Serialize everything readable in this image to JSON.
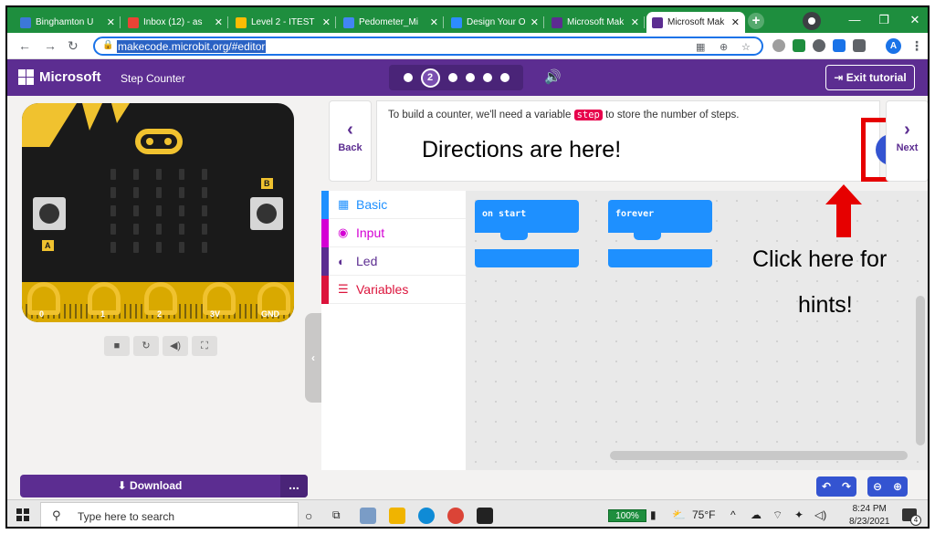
{
  "browser": {
    "tabs": [
      {
        "label": "Binghamton U",
        "color": "#3c78d8"
      },
      {
        "label": "Inbox (12) - as",
        "color": "#ea4335"
      },
      {
        "label": "Level 2 - ITEST",
        "color": "#fbbc04"
      },
      {
        "label": "Pedometer_Mi",
        "color": "#4285f4"
      },
      {
        "label": "Design Your O",
        "color": "#2d8cff"
      },
      {
        "label": "Microsoft Mak",
        "color": "#5c2d91"
      },
      {
        "label": "Microsoft Mak",
        "color": "#5c2d91"
      }
    ],
    "close_glyph": "✕",
    "new_tab": "+",
    "url": "makecode.microbit.org/#editor",
    "profile_initial": "A"
  },
  "header": {
    "brand": "Microsoft",
    "project": "Step Counter",
    "current_step": "2",
    "exit_label": "Exit tutorial"
  },
  "simulator": {
    "button_a": "A",
    "button_b": "B",
    "pins": [
      "0",
      "1",
      "2",
      "3V",
      "GND"
    ]
  },
  "tutorial": {
    "text_before": "To build a counter, we'll need a variable ",
    "variable": "step",
    "text_after": " to store the number of steps.",
    "back_label": "Back",
    "next_label": "Next"
  },
  "toolbox": {
    "categories": [
      {
        "label": "Basic",
        "color": "#1e90ff"
      },
      {
        "label": "Input",
        "color": "#d400d4"
      },
      {
        "label": "Led",
        "color": "#5c2d91"
      },
      {
        "label": "Variables",
        "color": "#dc143c"
      }
    ]
  },
  "workspace": {
    "blocks": [
      "on start",
      "forever"
    ]
  },
  "annotations": {
    "directions": "Directions are here!",
    "click": "Click here for",
    "hints": "hints!"
  },
  "bottom": {
    "download_label": "Download",
    "more_label": "..."
  },
  "taskbar": {
    "search_placeholder": "Type here to search",
    "battery": "100%",
    "temperature": "75°F",
    "time": "8:24 PM",
    "date": "8/23/2021",
    "notifications": "4"
  }
}
